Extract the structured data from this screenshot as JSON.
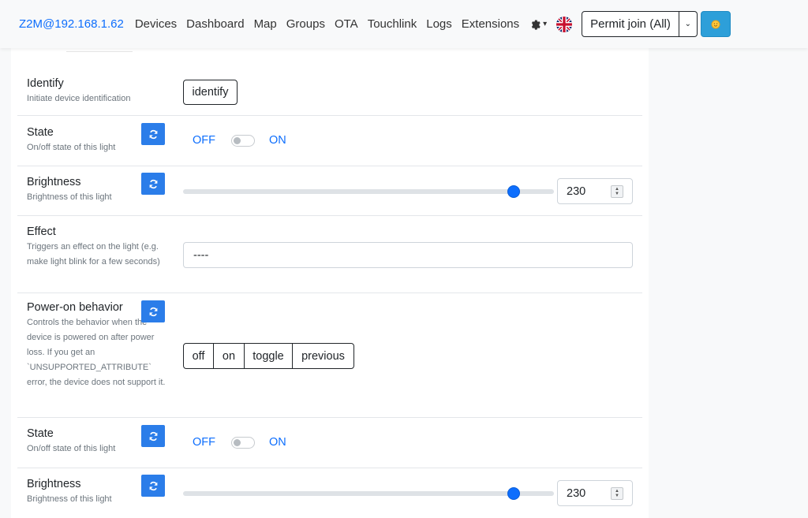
{
  "navbar": {
    "brand": "Z2M@192.168.1.62",
    "items": [
      "Devices",
      "Dashboard",
      "Map",
      "Groups",
      "OTA",
      "Touchlink",
      "Logs",
      "Extensions"
    ],
    "settings_icon": "gear-icon",
    "language_icon": "uk-flag-icon",
    "permit_join_label": "Permit join (All)",
    "theme_icon": "sun-icon"
  },
  "rows": {
    "identify": {
      "title": "Identify",
      "desc": "Initiate device identification",
      "button": "identify"
    },
    "state1": {
      "title": "State",
      "desc": "On/off state of this light",
      "off": "OFF",
      "on": "ON"
    },
    "brightness1": {
      "title": "Brightness",
      "desc": "Brightness of this light",
      "value": "230",
      "max": 254
    },
    "effect": {
      "title": "Effect",
      "desc": "Triggers an effect on the light (e.g. make light blink for a few seconds)",
      "selected": "----"
    },
    "power_on": {
      "title": "Power-on behavior",
      "desc": "Controls the behavior when the device is powered on after power loss. If you get an `UNSUPPORTED_ATTRIBUTE` error, the device does not support it.",
      "options": [
        "off",
        "on",
        "toggle",
        "previous"
      ]
    },
    "state2": {
      "title": "State",
      "desc": "On/off state of this light",
      "off": "OFF",
      "on": "ON"
    },
    "brightness2": {
      "title": "Brightness",
      "desc": "Brightness of this light",
      "value": "230",
      "max": 254
    }
  },
  "colors": {
    "accent": "#0d6efd",
    "refresh_button": "#2b7de9",
    "theme_button": "#2d9fd9"
  }
}
